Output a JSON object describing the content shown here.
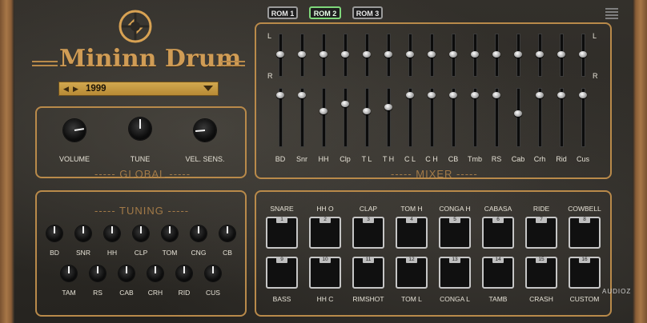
{
  "app": {
    "title": "Mininn Drum",
    "preset": "1999"
  },
  "roms": [
    {
      "label": "ROM 1",
      "active": false
    },
    {
      "label": "ROM 2",
      "active": true
    },
    {
      "label": "ROM 3",
      "active": false
    }
  ],
  "global": {
    "caption": "GLOBAL",
    "knobs": [
      {
        "label": "VOLUME",
        "value": 0.8
      },
      {
        "label": "TUNE",
        "value": 0.5
      },
      {
        "label": "VEL. SENS.",
        "value": 0.15
      }
    ]
  },
  "mixer": {
    "caption": "MIXER",
    "left_label": "L",
    "right_label": "R",
    "channels": [
      "BD",
      "Snr",
      "HH",
      "Clp",
      "T L",
      "T H",
      "C L",
      "C H",
      "CB",
      "Tmb",
      "RS",
      "Cab",
      "Crh",
      "Rid",
      "Cus"
    ],
    "pan": [
      0.5,
      0.5,
      0.5,
      0.5,
      0.5,
      0.5,
      0.5,
      0.5,
      0.5,
      0.5,
      0.5,
      0.5,
      0.5,
      0.5,
      0.5
    ],
    "level": [
      0.88,
      0.88,
      0.6,
      0.72,
      0.6,
      0.66,
      0.88,
      0.88,
      0.88,
      0.88,
      0.88,
      0.55,
      0.88,
      0.88,
      0.88
    ]
  },
  "tuning": {
    "caption": "TUNING",
    "row1": [
      "BD",
      "SNR",
      "HH",
      "CLP",
      "TOM",
      "CNG",
      "CB"
    ],
    "row2": [
      "TAM",
      "RS",
      "CAB",
      "CRH",
      "RID",
      "CUS"
    ]
  },
  "pads": {
    "top": [
      {
        "name": "SNARE",
        "num": "1"
      },
      {
        "name": "HH O",
        "num": "2"
      },
      {
        "name": "CLAP",
        "num": "3"
      },
      {
        "name": "TOM H",
        "num": "4"
      },
      {
        "name": "CONGA H",
        "num": "5"
      },
      {
        "name": "CABASA",
        "num": "6"
      },
      {
        "name": "RIDE",
        "num": "7"
      },
      {
        "name": "COWBELL",
        "num": "8"
      }
    ],
    "bottom": [
      {
        "name": "BASS",
        "num": "9"
      },
      {
        "name": "HH C",
        "num": "10"
      },
      {
        "name": "RIMSHOT",
        "num": "11"
      },
      {
        "name": "TOM L",
        "num": "12"
      },
      {
        "name": "CONGA L",
        "num": "13"
      },
      {
        "name": "TAMB",
        "num": "14"
      },
      {
        "name": "CRASH",
        "num": "15"
      },
      {
        "name": "CUSTOM",
        "num": "16"
      }
    ]
  },
  "watermark": "AUDIOZ",
  "colors": {
    "accent": "#b98a4a",
    "active_rom": "#7fd87b",
    "preset_bg": "#c99d44"
  }
}
